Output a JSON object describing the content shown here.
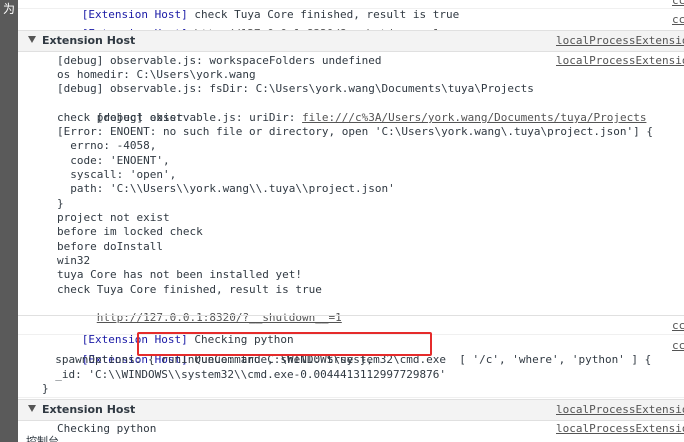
{
  "gutter": {
    "glyph": "为"
  },
  "top": {
    "row1_tag": "[Extension Host]",
    "row1_text": " check Tuya Core finished, result is true",
    "row1_src": "cc",
    "row2_tag": "[Extension Host]",
    "row2_url": "http://127.0.0.1:8320/?__shutdown__=1",
    "row2_src": "cc"
  },
  "group1": {
    "title": "Extension Host",
    "source": "localProcessExtensio",
    "source2": "localProcessExtensio",
    "lines": [
      "[debug] observable.js: workspaceFolders undefined",
      "os homedir: C:\\Users\\york.wang",
      "[debug] observable.js: fsDir: C:\\Users\\york.wang\\Documents\\tuya\\Projects"
    ],
    "uri_prefix": "[debug] observable.js: uriDir: ",
    "uri_link": "file:///c%3A/Users/york.wang/Documents/tuya/Projects",
    "lines2": [
      "check project exist.",
      "[Error: ENOENT: no such file or directory, open 'C:\\Users\\york.wang\\.tuya\\project.json'] {",
      "  errno: -4058,",
      "  code: 'ENOENT',",
      "  syscall: 'open',",
      "  path: 'C:\\\\Users\\\\york.wang\\\\.tuya\\\\project.json'",
      "}",
      "project not exist",
      "before im locked check",
      "before doInstall",
      "win32",
      "tuya Core has not been installed yet!",
      "check Tuya Core finished, result is true"
    ],
    "end_link": "http://127.0.0.1:8320/?__shutdown__=1"
  },
  "row3": {
    "tag": "[Extension Host]",
    "text": " Checking python",
    "src": "cc"
  },
  "row4": {
    "tag": "[Extension Host]",
    "text": " runCommand C:\\WINDOWS\\system32\\cmd.exe  [ '/c', 'where', 'python' ] {",
    "line2": "  spawnOptions: { runInQueue: true, shell: true },",
    "line3": "  _id: 'C:\\\\WINDOWS\\\\system32\\\\cmd.exe-0.0044413112997729876'",
    "line4": "}",
    "src": "cc"
  },
  "group2": {
    "title": "Extension Host",
    "source": "localProcessExtensio",
    "line": "Checking python",
    "src2": "localProcessExtensio"
  },
  "footer": {
    "text": "控制台"
  }
}
